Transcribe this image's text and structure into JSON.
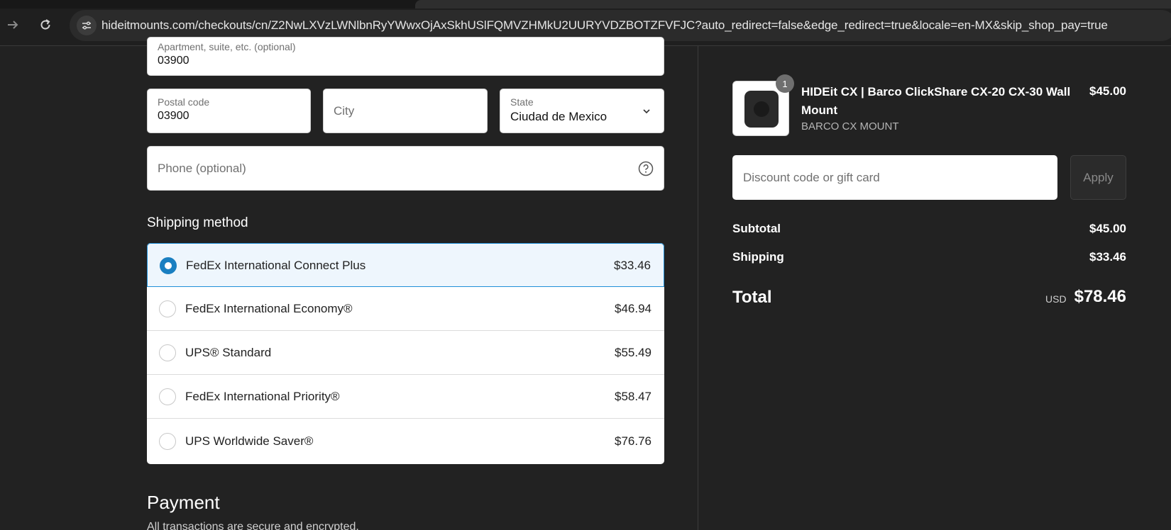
{
  "browser": {
    "url": "hideitmounts.com/checkouts/cn/Z2NwLXVzLWNlbnRyYWwxOjAxSkhUSlFQMVZHMkU2UURYVDZBOTZFVFJC?auto_redirect=false&edge_redirect=true&locale=en-MX&skip_shop_pay=true"
  },
  "address": {
    "apartment_label": "Apartment, suite, etc. (optional)",
    "apartment_value": "03900",
    "postal_label": "Postal code",
    "postal_value": "03900",
    "city_placeholder": "City",
    "state_label": "State",
    "state_value": "Ciudad de Mexico",
    "phone_placeholder": "Phone (optional)"
  },
  "shipping": {
    "title": "Shipping method",
    "options": [
      {
        "name": "FedEx International Connect Plus",
        "price": "$33.46",
        "selected": true
      },
      {
        "name": "FedEx International Economy®",
        "price": "$46.94",
        "selected": false
      },
      {
        "name": "UPS® Standard",
        "price": "$55.49",
        "selected": false
      },
      {
        "name": "FedEx International Priority®",
        "price": "$58.47",
        "selected": false
      },
      {
        "name": "UPS Worldwide Saver®",
        "price": "$76.76",
        "selected": false
      }
    ]
  },
  "payment": {
    "title": "Payment",
    "subtitle": "All transactions are secure and encrypted."
  },
  "summary": {
    "product": {
      "quantity": "1",
      "title": "HIDEit CX | Barco ClickShare CX-20 CX-30 Wall Mount",
      "variant": "BARCO CX MOUNT",
      "price": "$45.00"
    },
    "discount_placeholder": "Discount code or gift card",
    "apply_label": "Apply",
    "subtotal_label": "Subtotal",
    "subtotal_value": "$45.00",
    "shipping_label": "Shipping",
    "shipping_value": "$33.46",
    "total_label": "Total",
    "total_currency": "USD",
    "total_value": "$78.46"
  },
  "colors": {
    "background": "#222222",
    "accent": "#1a7fc1"
  }
}
